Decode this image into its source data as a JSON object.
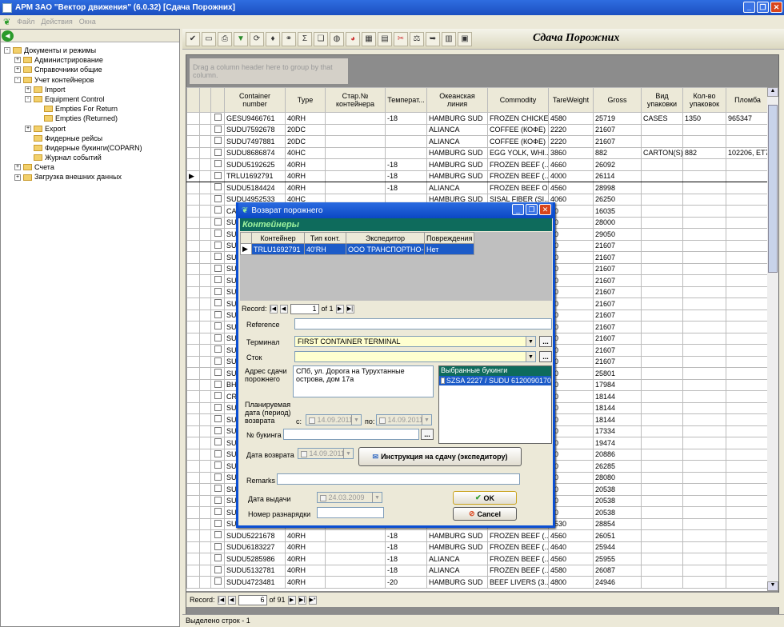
{
  "window": {
    "title": "АРМ ЗАО \"Вектор движения\" (6.0.32)  [Сдача Порожних]",
    "btn_min": "_",
    "btn_max": "❐",
    "btn_close": "✕"
  },
  "menu": {
    "icon": "leaf-icon",
    "items": [
      "Файл",
      "Действия",
      "Окна"
    ]
  },
  "tree": [
    {
      "label": "Документы и режимы",
      "level": 0,
      "exp": "-"
    },
    {
      "label": "Администрирование",
      "level": 1,
      "exp": "+"
    },
    {
      "label": "Справочники общие",
      "level": 1,
      "exp": "+"
    },
    {
      "label": "Учет контейнеров",
      "level": 1,
      "exp": "-"
    },
    {
      "label": "Import",
      "level": 2,
      "exp": "+"
    },
    {
      "label": "Equipment Control",
      "level": 2,
      "exp": "-"
    },
    {
      "label": "Empties For Return",
      "level": 3,
      "exp": ""
    },
    {
      "label": "Empties (Returned)",
      "level": 3,
      "exp": ""
    },
    {
      "label": "Export",
      "level": 2,
      "exp": "+"
    },
    {
      "label": "Фидерные рейсы",
      "level": 2,
      "exp": ""
    },
    {
      "label": "Фидерные букинги(COPARN)",
      "level": 2,
      "exp": ""
    },
    {
      "label": "Журнал событий",
      "level": 2,
      "exp": ""
    },
    {
      "label": "Счета",
      "level": 1,
      "exp": "+"
    },
    {
      "label": "Загрузка внешних данных",
      "level": 1,
      "exp": "+"
    }
  ],
  "page_title": "Сдача Порожних",
  "group_hint": "Drag a column header here to group by that column.",
  "columns": [
    "Container number",
    "Type",
    "Стар.№ контейнера",
    "Температ...",
    "Океанская линия",
    "Commodity",
    "TareWeight",
    "Gross",
    "Вид упаковки",
    "Кол-во упаковок",
    "Пломба"
  ],
  "rows": [
    [
      "GESU9466761",
      "40RH",
      "",
      "-18",
      "HAMBURG SUD",
      "FROZEN CHICKE...",
      "4580",
      "25719",
      "CASES",
      "1350",
      "965347"
    ],
    [
      "SUDU7592678",
      "20DC",
      "",
      "",
      "ALIANCA",
      "COFFEE (КОФЕ)",
      "2220",
      "21607",
      "",
      "",
      ""
    ],
    [
      "SUDU7497881",
      "20DC",
      "",
      "",
      "ALIANCA",
      "COFFEE (КОФЕ)",
      "2220",
      "21607",
      "",
      "",
      ""
    ],
    [
      "SUDU8686874",
      "40HC",
      "",
      "",
      "HAMBURG SUD",
      "EGG YOLK, WHI...",
      "3860",
      "882",
      "CARTON(S)",
      "882",
      "102206, ET733"
    ],
    [
      "SUDU5192625",
      "40RH",
      "",
      "-18",
      "HAMBURG SUD",
      "FROZEN BEEF (...",
      "4660",
      "26092",
      "",
      "",
      ""
    ],
    [
      "TRLU1692791",
      "40RH",
      "",
      "-18",
      "HAMBURG SUD",
      "FROZEN BEEF (...",
      "4000",
      "26114",
      "",
      "",
      ""
    ],
    [
      "SUDU5184424",
      "40RH",
      "",
      "-18",
      "ALIANCA",
      "FROZEN BEEF O...",
      "4560",
      "28998",
      "",
      "",
      ""
    ],
    [
      "SUDU4952533",
      "40HC",
      "",
      "",
      "HAMBURG SUD",
      "SISAL FIBER (SI...",
      "4060",
      "26250",
      "",
      "",
      ""
    ],
    [
      "CAI",
      "",
      "",
      "",
      "",
      "",
      "00",
      "16035",
      "",
      "",
      ""
    ],
    [
      "SUI",
      "",
      "",
      "",
      "",
      "",
      "20",
      "28000",
      "",
      "",
      ""
    ],
    [
      "SUI",
      "",
      "",
      "",
      "",
      "",
      "50",
      "29050",
      "",
      "",
      ""
    ],
    [
      "SUI",
      "",
      "",
      "",
      "",
      "",
      "20",
      "21607",
      "",
      "",
      ""
    ],
    [
      "SUI",
      "",
      "",
      "",
      "",
      "",
      "20",
      "21607",
      "",
      "",
      ""
    ],
    [
      "SUI",
      "",
      "",
      "",
      "",
      "",
      "20",
      "21607",
      "",
      "",
      ""
    ],
    [
      "SUI",
      "",
      "",
      "",
      "",
      "",
      "20",
      "21607",
      "",
      "",
      ""
    ],
    [
      "SUI",
      "",
      "",
      "",
      "",
      "",
      "20",
      "21607",
      "",
      "",
      ""
    ],
    [
      "SUI",
      "",
      "",
      "",
      "",
      "",
      "20",
      "21607",
      "",
      "",
      ""
    ],
    [
      "SUI",
      "",
      "",
      "",
      "",
      "",
      "20",
      "21607",
      "",
      "",
      ""
    ],
    [
      "SUI",
      "",
      "",
      "",
      "",
      "",
      "20",
      "21607",
      "",
      "",
      ""
    ],
    [
      "SUI",
      "",
      "",
      "",
      "",
      "",
      "20",
      "21607",
      "",
      "",
      ""
    ],
    [
      "SUI",
      "",
      "",
      "",
      "",
      "",
      "20",
      "21607",
      "",
      "",
      ""
    ],
    [
      "SUI",
      "",
      "",
      "",
      "",
      "",
      "20",
      "21607",
      "",
      "",
      ""
    ],
    [
      "SUI",
      "",
      "",
      "",
      "",
      "",
      "60",
      "25801",
      "",
      "",
      ""
    ],
    [
      "BH",
      "",
      "",
      "",
      "",
      "",
      "10",
      "17984",
      "",
      "",
      ""
    ],
    [
      "CR",
      "",
      "",
      "",
      "",
      "",
      "00",
      "18144",
      "",
      "",
      ""
    ],
    [
      "SUI",
      "",
      "",
      "",
      "",
      "",
      "60",
      "18144",
      "",
      "",
      ""
    ],
    [
      "SUI",
      "",
      "",
      "",
      "",
      "",
      "60",
      "18144",
      "",
      "",
      ""
    ],
    [
      "SUI",
      "",
      "",
      "",
      "",
      "",
      "00",
      "17334",
      "",
      "",
      ""
    ],
    [
      "SUI",
      "",
      "",
      "",
      "",
      "",
      "60",
      "19474",
      "",
      "",
      ""
    ],
    [
      "SUI",
      "",
      "",
      "",
      "",
      "",
      "20",
      "20886",
      "",
      "",
      ""
    ],
    [
      "SUI",
      "",
      "",
      "",
      "",
      "",
      "30",
      "26285",
      "",
      "",
      ""
    ],
    [
      "SUI",
      "",
      "",
      "",
      "",
      "",
      "20",
      "28080",
      "",
      "",
      ""
    ],
    [
      "SUI",
      "",
      "",
      "",
      "",
      "",
      "60",
      "20538",
      "",
      "",
      ""
    ],
    [
      "SUI",
      "",
      "",
      "",
      "",
      "",
      "60",
      "20538",
      "",
      "",
      ""
    ],
    [
      "SUI",
      "",
      "",
      "",
      "",
      "",
      "60",
      "20538",
      "",
      "",
      ""
    ],
    [
      "SUDU5131804",
      "40RH",
      "",
      "-18",
      "HAMBURG SUD",
      "BEEF LIVERS (3...",
      "4530",
      "28854",
      "",
      "",
      ""
    ],
    [
      "SUDU5221678",
      "40RH",
      "",
      "-18",
      "HAMBURG SUD",
      "FROZEN BEEF (...",
      "4560",
      "26051",
      "",
      "",
      ""
    ],
    [
      "SUDU6183227",
      "40RH",
      "",
      "-18",
      "HAMBURG SUD",
      "FROZEN BEEF (...",
      "4640",
      "25944",
      "",
      "",
      ""
    ],
    [
      "SUDU5285986",
      "40RH",
      "",
      "-18",
      "ALIANCA",
      "FROZEN BEEF (...",
      "4560",
      "25955",
      "",
      "",
      ""
    ],
    [
      "SUDU5132781",
      "40RH",
      "",
      "-18",
      "ALIANCA",
      "FROZEN BEEF (...",
      "4580",
      "26087",
      "",
      "",
      ""
    ],
    [
      "SUDU4723481",
      "40RH",
      "",
      "-20",
      "HAMBURG SUD",
      "BEEF LIVERS (3...",
      "4800",
      "24946",
      "",
      "",
      ""
    ]
  ],
  "selected_row": 5,
  "record_nav": {
    "label": "Record:",
    "current": "6",
    "of": "of 91"
  },
  "status": "Выделено строк - 1",
  "dialog": {
    "title": "Возврат порожнего",
    "section": "Контейнеры",
    "inner_columns": [
      "Контейнер",
      "Тип конт.",
      "Экспедитор",
      "Повреждения"
    ],
    "inner_row": [
      "TRLU1692791",
      "40'RH",
      "ООО ТРАНСПОРТНО-...",
      "Нет"
    ],
    "nav": {
      "label": "Record:",
      "current": "1",
      "of": "of 1"
    },
    "reference_label": "Reference",
    "terminal_label": "Терминал",
    "terminal_value": "FIRST CONTAINER TERMINAL",
    "stock_label": "Сток",
    "address_label": "Адрес сдачи порожнего",
    "address_value": "СПб, ул. Дорога на Турухтанные острова, дом 17а",
    "bookings_header": "Выбранные букинги",
    "booking_item": "SZSA 2227 / SUDU 6120090170",
    "planned_label": "Планируемая дата (период) возврата",
    "from_label": "с:",
    "from_value": "14.09.2011",
    "to_label": "по:",
    "to_value": "14.09.2011",
    "booking_no_label": "№ букинга",
    "return_date_label": "Дата возврата",
    "return_date_value": "14.09.2011",
    "instruction_btn": "Инструкция на сдачу (экспедитору)",
    "remarks_label": "Remarks",
    "issue_date_label": "Дата выдачи",
    "issue_date_value": "24.03.2009",
    "razn_label": "Номер разнарядки",
    "ok": "OK",
    "cancel": "Cancel"
  }
}
